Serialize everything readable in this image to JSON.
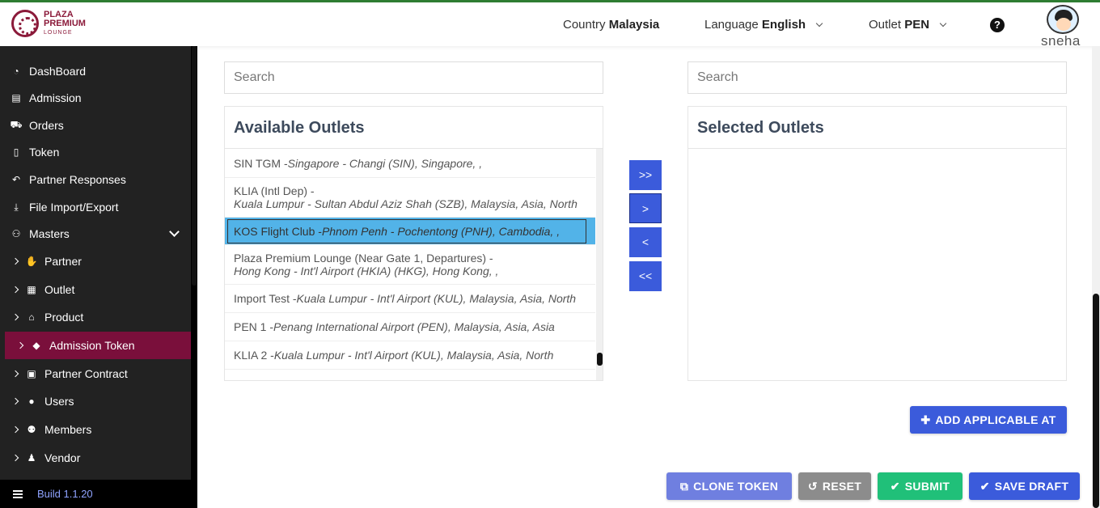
{
  "brand": {
    "line1": "PLAZA",
    "line2": "PREMIUM",
    "line3": "LOUNGE"
  },
  "header": {
    "country_label": "Country",
    "country_value": "Malaysia",
    "language_label": "Language",
    "language_value": "English",
    "outlet_label": "Outlet",
    "outlet_value": "PEN",
    "user_name": "sneha"
  },
  "sidebar": {
    "items": [
      {
        "label": "DashBoard",
        "icon": "dashboard-icon"
      },
      {
        "label": "Admission",
        "icon": "id-card-icon"
      },
      {
        "label": "Orders",
        "icon": "cart-icon"
      },
      {
        "label": "Token",
        "icon": "file-icon"
      },
      {
        "label": "Partner Responses",
        "icon": "reply-icon"
      },
      {
        "label": "File Import/Export",
        "icon": "download-icon"
      },
      {
        "label": "Masters",
        "icon": "sitemap-icon"
      }
    ],
    "sub_items": [
      {
        "label": "Partner",
        "icon": "handshake-icon"
      },
      {
        "label": "Outlet",
        "icon": "building-icon"
      },
      {
        "label": "Product",
        "icon": "gift-icon"
      },
      {
        "label": "Admission Token",
        "icon": "ticket-icon"
      },
      {
        "label": "Partner Contract",
        "icon": "briefcase-icon"
      },
      {
        "label": "Users",
        "icon": "user-icon"
      },
      {
        "label": "Members",
        "icon": "users-icon"
      },
      {
        "label": "Vendor",
        "icon": "person-icon"
      }
    ],
    "build": "Build 1.1.20"
  },
  "available": {
    "search_placeholder": "Search",
    "title": "Available Outlets",
    "items": [
      {
        "name": "SIN TGM -",
        "location": "Singapore - Changi (SIN), Singapore, ,"
      },
      {
        "name": "KLIA (Intl Dep) -",
        "location": "Kuala Lumpur - Sultan Abdul Aziz Shah (SZB), Malaysia, Asia, North"
      },
      {
        "name": "KOS Flight Club -",
        "location": "Phnom Penh - Pochentong (PNH), Cambodia, ,"
      },
      {
        "name": "Plaza Premium Lounge (Near Gate 1, Departures) -",
        "location": "Hong Kong - Int'l Airport (HKIA) (HKG), Hong Kong, ,"
      },
      {
        "name": "Import Test -",
        "location": "Kuala Lumpur - Int'l Airport (KUL), Malaysia, Asia, North"
      },
      {
        "name": "PEN 1 -",
        "location": "Penang International Airport (PEN), Malaysia, Asia, Asia"
      },
      {
        "name": "KLIA 2 -",
        "location": "Kuala Lumpur - Int'l Airport (KUL), Malaysia, Asia, North"
      }
    ]
  },
  "selected": {
    "search_placeholder": "Search",
    "title": "Selected Outlets"
  },
  "transfer": {
    "move_all_right": ">>",
    "move_right": ">",
    "move_left": "<",
    "move_all_left": "<<"
  },
  "actions": {
    "add_applicable": "ADD APPLICABLE AT",
    "clone": "CLONE TOKEN",
    "reset": "RESET",
    "submit": "SUBMIT",
    "save_draft": "SAVE DRAFT"
  },
  "colors": {
    "sidebar_bg": "#222222",
    "active_item": "#7a0f3b",
    "primary": "#3b5bdb",
    "selected_row": "#52b3e8",
    "submit": "#20c079",
    "reset": "#8c8c8c",
    "clone": "#6f7fe0"
  }
}
